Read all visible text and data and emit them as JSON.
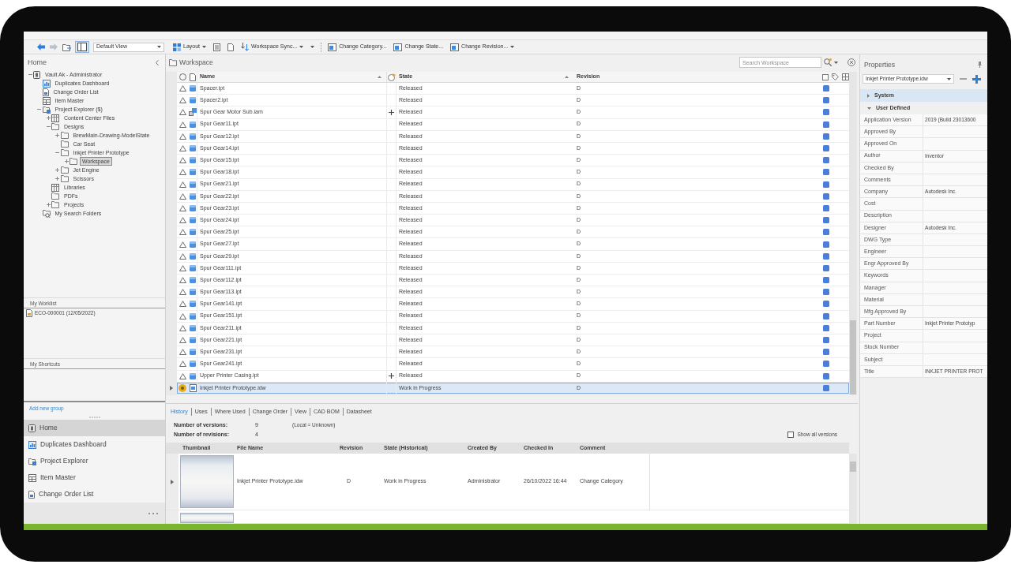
{
  "toolbar": {
    "nav_buttons": [
      {
        "kind": "back",
        "disabled": false
      },
      {
        "kind": "forward",
        "disabled": true
      },
      {
        "kind": "folder",
        "disabled": false
      }
    ],
    "pane_toggle": {
      "pressed": true
    },
    "view_select": "Default View",
    "command_groups": [
      {
        "commands": [
          {
            "kind": "layout",
            "label": "Layout",
            "caret": true
          },
          {
            "kind": "list",
            "caret": false
          },
          {
            "kind": "document",
            "caret": false
          },
          {
            "kind": "sync",
            "label": "Workspace Sync...",
            "caret": true
          },
          {
            "kind": "dropdown",
            "caret": true
          }
        ]
      },
      {
        "commands": [
          {
            "kind": "change",
            "label": "Change Category...",
            "caret": false
          },
          {
            "kind": "change",
            "label": "Change State...",
            "caret": false
          },
          {
            "kind": "change",
            "label": "Change Revision...",
            "caret": true
          }
        ]
      }
    ]
  },
  "navigator": {
    "title": "Home",
    "tree": [
      {
        "label": "Vault Ak - Administrator",
        "kind": "vault",
        "expanded": true,
        "selected": false,
        "children": [
          {
            "label": "Duplicates Dashboard",
            "kind": "dashboard",
            "selected": false
          },
          {
            "label": "Change Order List",
            "kind": "change-order",
            "selected": false
          },
          {
            "label": "Item Master",
            "kind": "item-master",
            "selected": false
          },
          {
            "label": "Project Explorer ($)",
            "kind": "explorer",
            "expanded": true,
            "selected": false,
            "children": [
              {
                "label": "Content Center Files",
                "kind": "library",
                "expanded": false,
                "selected": false
              },
              {
                "label": "Designs",
                "kind": "folder",
                "expanded": true,
                "selected": false,
                "children": [
                  {
                    "label": "BrewMain-Drawing-ModelState",
                    "kind": "folder",
                    "expanded": false,
                    "selected": false
                  },
                  {
                    "label": "Car Seat",
                    "kind": "folder",
                    "selected": false
                  },
                  {
                    "label": "Inkjet Printer Prototype",
                    "kind": "folder",
                    "expanded": true,
                    "selected": false,
                    "children": [
                      {
                        "label": "Workspace",
                        "kind": "folder",
                        "expanded": false,
                        "selected": true
                      }
                    ]
                  },
                  {
                    "label": "Jet Engine",
                    "kind": "folder",
                    "expanded": false,
                    "selected": false
                  },
                  {
                    "label": "Scissors",
                    "kind": "folder",
                    "expanded": false,
                    "selected": false
                  }
                ]
              },
              {
                "label": "Libraries",
                "kind": "library",
                "selected": false
              },
              {
                "label": "PDFs",
                "kind": "folder",
                "selected": false
              },
              {
                "label": "Projects",
                "kind": "folder",
                "expanded": false,
                "selected": false
              }
            ]
          },
          {
            "label": "My Search Folders",
            "kind": "search-folder",
            "selected": false
          }
        ]
      }
    ],
    "worklist": {
      "title": "My Worklist",
      "items": [
        {
          "label": "ECO-000001 (12/05/2022)"
        }
      ]
    },
    "shortcuts": {
      "title": "My Shortcuts"
    },
    "add_group_link": "Add new group",
    "nav_items": [
      {
        "kind": "home",
        "label": "Home",
        "selected": true
      },
      {
        "kind": "dashboard",
        "label": "Duplicates Dashboard",
        "selected": false
      },
      {
        "kind": "explorer",
        "label": "Project Explorer",
        "selected": false
      },
      {
        "kind": "item-master",
        "label": "Item Master",
        "selected": false
      },
      {
        "kind": "change-order",
        "label": "Change Order List",
        "selected": false
      }
    ]
  },
  "workspace": {
    "title": "Workspace",
    "search": {
      "placeholder": "Search Workspace"
    },
    "columns": [
      {
        "label": "Name",
        "sorted": true
      },
      {
        "label": "State",
        "sorted": true
      },
      {
        "label": "Revision",
        "sorted": false
      }
    ],
    "rows": [
      {
        "name": "Spacer.ipt",
        "kind": "part",
        "status": {
          "kind": "triangle"
        },
        "marked": false,
        "state": "Released",
        "revision": "D",
        "selected": false
      },
      {
        "name": "Spacer2.ipt",
        "kind": "part",
        "status": {
          "kind": "triangle"
        },
        "marked": false,
        "state": "Released",
        "revision": "D",
        "selected": false
      },
      {
        "name": "Spur Gear Motor Sub.iam",
        "kind": "assembly",
        "status": {
          "kind": "triangle"
        },
        "marked": true,
        "state": "Released",
        "revision": "D",
        "selected": false
      },
      {
        "name": "Spur Gear11.ipt",
        "kind": "part",
        "status": {
          "kind": "triangle"
        },
        "marked": false,
        "state": "Released",
        "revision": "D",
        "selected": false
      },
      {
        "name": "Spur Gear12.ipt",
        "kind": "part",
        "status": {
          "kind": "triangle"
        },
        "marked": false,
        "state": "Released",
        "revision": "D",
        "selected": false
      },
      {
        "name": "Spur Gear14.ipt",
        "kind": "part",
        "status": {
          "kind": "triangle"
        },
        "marked": false,
        "state": "Released",
        "revision": "D",
        "selected": false
      },
      {
        "name": "Spur Gear15.ipt",
        "kind": "part",
        "status": {
          "kind": "triangle"
        },
        "marked": false,
        "state": "Released",
        "revision": "D",
        "selected": false
      },
      {
        "name": "Spur Gear18.ipt",
        "kind": "part",
        "status": {
          "kind": "triangle"
        },
        "marked": false,
        "state": "Released",
        "revision": "D",
        "selected": false
      },
      {
        "name": "Spur Gear21.ipt",
        "kind": "part",
        "status": {
          "kind": "triangle"
        },
        "marked": false,
        "state": "Released",
        "revision": "D",
        "selected": false
      },
      {
        "name": "Spur Gear22.ipt",
        "kind": "part",
        "status": {
          "kind": "triangle"
        },
        "marked": false,
        "state": "Released",
        "revision": "D",
        "selected": false
      },
      {
        "name": "Spur Gear23.ipt",
        "kind": "part",
        "status": {
          "kind": "triangle"
        },
        "marked": false,
        "state": "Released",
        "revision": "D",
        "selected": false
      },
      {
        "name": "Spur Gear24.ipt",
        "kind": "part",
        "status": {
          "kind": "triangle"
        },
        "marked": false,
        "state": "Released",
        "revision": "D",
        "selected": false
      },
      {
        "name": "Spur Gear25.ipt",
        "kind": "part",
        "status": {
          "kind": "triangle"
        },
        "marked": false,
        "state": "Released",
        "revision": "D",
        "selected": false
      },
      {
        "name": "Spur Gear27.ipt",
        "kind": "part",
        "status": {
          "kind": "triangle"
        },
        "marked": false,
        "state": "Released",
        "revision": "D",
        "selected": false
      },
      {
        "name": "Spur Gear29.ipt",
        "kind": "part",
        "status": {
          "kind": "triangle"
        },
        "marked": false,
        "state": "Released",
        "revision": "D",
        "selected": false
      },
      {
        "name": "Spur Gear111.ipt",
        "kind": "part",
        "status": {
          "kind": "triangle"
        },
        "marked": false,
        "state": "Released",
        "revision": "D",
        "selected": false
      },
      {
        "name": "Spur Gear112.ipt",
        "kind": "part",
        "status": {
          "kind": "triangle"
        },
        "marked": false,
        "state": "Released",
        "revision": "D",
        "selected": false
      },
      {
        "name": "Spur Gear113.ipt",
        "kind": "part",
        "status": {
          "kind": "triangle"
        },
        "marked": false,
        "state": "Released",
        "revision": "D",
        "selected": false
      },
      {
        "name": "Spur Gear141.ipt",
        "kind": "part",
        "status": {
          "kind": "triangle"
        },
        "marked": false,
        "state": "Released",
        "revision": "D",
        "selected": false
      },
      {
        "name": "Spur Gear151.ipt",
        "kind": "part",
        "status": {
          "kind": "triangle"
        },
        "marked": false,
        "state": "Released",
        "revision": "D",
        "selected": false
      },
      {
        "name": "Spur Gear211.ipt",
        "kind": "part",
        "status": {
          "kind": "triangle"
        },
        "marked": false,
        "state": "Released",
        "revision": "D",
        "selected": false
      },
      {
        "name": "Spur Gear221.ipt",
        "kind": "part",
        "status": {
          "kind": "triangle"
        },
        "marked": false,
        "state": "Released",
        "revision": "D",
        "selected": false
      },
      {
        "name": "Spur Gear231.ipt",
        "kind": "part",
        "status": {
          "kind": "triangle"
        },
        "marked": false,
        "state": "Released",
        "revision": "D",
        "selected": false
      },
      {
        "name": "Spur Gear241.ipt",
        "kind": "part",
        "status": {
          "kind": "triangle"
        },
        "marked": false,
        "state": "Released",
        "revision": "D",
        "selected": false
      },
      {
        "name": "Upper Printer Casing.ipt",
        "kind": "part",
        "status": {
          "kind": "triangle"
        },
        "marked": true,
        "state": "Released",
        "revision": "D",
        "selected": false
      },
      {
        "name": "Inkjet Printer Prototype.idw",
        "kind": "drawing",
        "status": {
          "kind": "circle"
        },
        "marked": false,
        "state": "Work in Progress",
        "revision": "D",
        "selected": true
      }
    ]
  },
  "details": {
    "tabs": [
      {
        "label": "History",
        "selected": true
      },
      {
        "label": "Uses",
        "selected": false
      },
      {
        "label": "Where Used",
        "selected": false
      },
      {
        "label": "Change Order",
        "selected": false
      },
      {
        "label": "View",
        "selected": false
      },
      {
        "label": "CAD BOM",
        "selected": false
      },
      {
        "label": "Datasheet",
        "selected": false
      }
    ],
    "stats": [
      {
        "label": "Number of versions:",
        "value": "9",
        "note": "(Local = Unknown)"
      },
      {
        "label": "Number of revisions:",
        "value": "4"
      }
    ],
    "show_all_versions": {
      "label": "Show all versions",
      "checked": false
    },
    "history": {
      "columns": [
        "Thumbnail",
        "File Name",
        "Revision",
        "State (Historical)",
        "Created By",
        "Checked In",
        "Comment"
      ],
      "rows": [
        {
          "kind": "full",
          "cells": [
            "Inkjet Printer Prototype.idw",
            "D",
            "Work in Progress",
            "Administrator",
            "26/10/2022 16:44",
            "Change Category"
          ]
        },
        {
          "kind": "partial"
        }
      ]
    }
  },
  "properties": {
    "title": "Properties",
    "file_select": "Inkjet Printer Prototype.idw",
    "groups": [
      {
        "label": "System",
        "expanded": false,
        "selected": true
      },
      {
        "label": "User Defined",
        "expanded": true,
        "selected": false,
        "items": [
          {
            "name": "Application Version",
            "value": "2019 (Build 23013600"
          },
          {
            "name": "Approved By"
          },
          {
            "name": "Approved On"
          },
          {
            "name": "Author",
            "value": "Inventor"
          },
          {
            "name": "Checked By"
          },
          {
            "name": "Comments"
          },
          {
            "name": "Company",
            "value": "Autodesk Inc."
          },
          {
            "name": "Cost"
          },
          {
            "name": "Description"
          },
          {
            "name": "Designer",
            "value": "Autodesk Inc."
          },
          {
            "name": "DWG Type"
          },
          {
            "name": "Engineer"
          },
          {
            "name": "Engr Approved By"
          },
          {
            "name": "Keywords"
          },
          {
            "name": "Manager"
          },
          {
            "name": "Material"
          },
          {
            "name": "Mfg Approved By"
          },
          {
            "name": "Part Number",
            "value": "Inkjet Printer Prototyp"
          },
          {
            "name": "Project"
          },
          {
            "name": "Stock Number"
          },
          {
            "name": "Subject"
          },
          {
            "name": "Title",
            "value": "INKJET PRINTER PROT"
          }
        ]
      }
    ]
  }
}
